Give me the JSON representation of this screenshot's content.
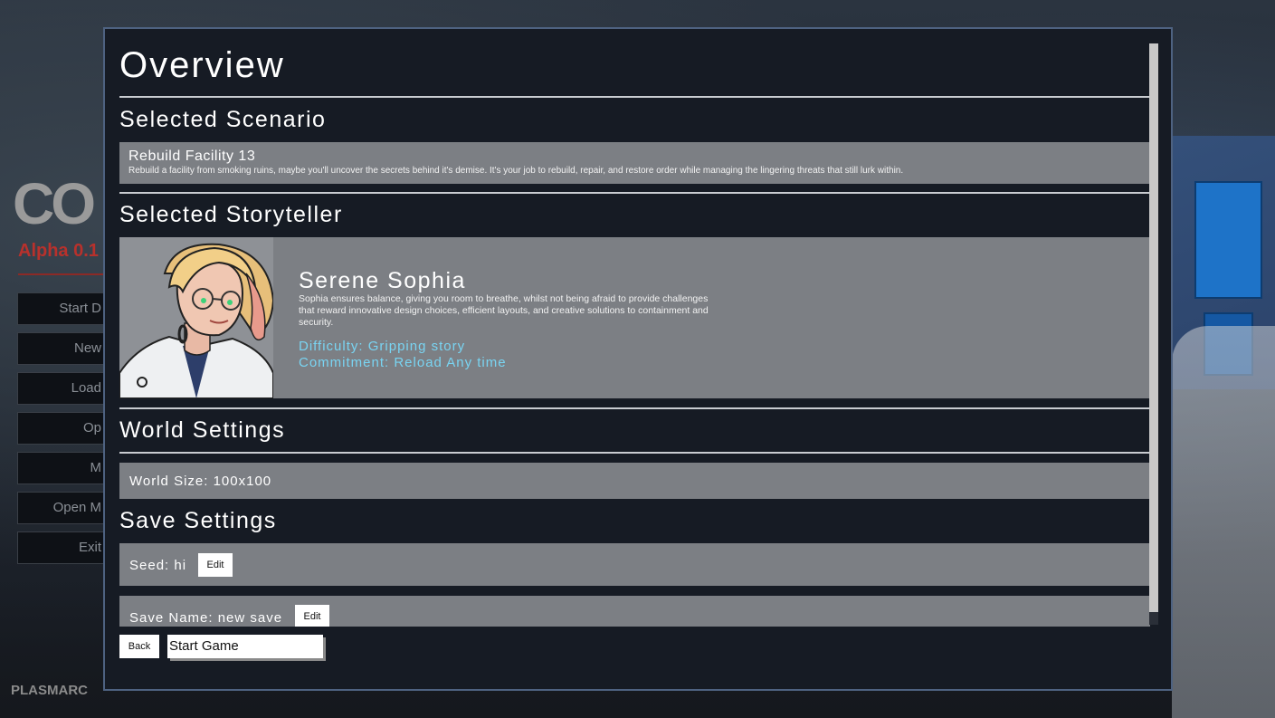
{
  "background": {
    "logo_text": "CO",
    "version": "Alpha 0.1",
    "menu": [
      "Start D",
      "New",
      "Load",
      "Op",
      "M",
      "Open M",
      "Exit"
    ],
    "studio": "PLASMARC"
  },
  "overview": {
    "title": "Overview",
    "scenario": {
      "heading": "Selected Scenario",
      "name": "Rebuild Facility 13",
      "description": "Rebuild a facility from smoking ruins, maybe you'll uncover the secrets behind it's demise. It's your job to rebuild, repair, and restore order while managing the lingering threats that still lurk within."
    },
    "storyteller": {
      "heading": "Selected Storyteller",
      "name": "Serene Sophia",
      "description": " Sophia ensures balance, giving you room to breathe, whilst not being afraid to provide challenges that reward innovative design choices, efficient layouts, and creative solutions to containment and security.",
      "difficulty": "Difficulty: Gripping story",
      "commitment": "Commitment: Reload Any time"
    },
    "world": {
      "heading": "World Settings",
      "size": "World Size: 100x100"
    },
    "save": {
      "heading": "Save Settings",
      "seed_label": "Seed:  hi",
      "name_label": "Save Name:  new save",
      "edit_label": "Edit"
    },
    "buttons": {
      "back": "Back",
      "start": "Start Game"
    }
  },
  "colors": {
    "accent_text": "#79d4f2",
    "card_bg": "#7c7f84",
    "dialog_bg": "#161b24",
    "dialog_border": "#4e6281"
  }
}
